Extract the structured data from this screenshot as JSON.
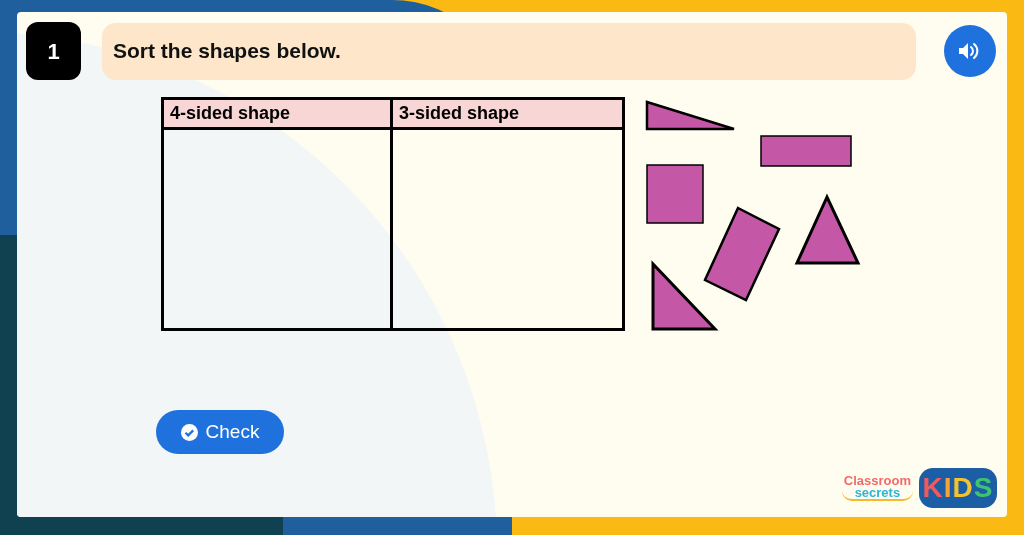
{
  "question": {
    "number": "1",
    "prompt": "Sort the shapes below."
  },
  "table": {
    "columns": [
      "4-sided shape",
      "3-sided shape"
    ]
  },
  "check_button": {
    "label": "Check"
  },
  "logo": {
    "line_1": "Classroom",
    "line_2": "secrets",
    "badge": "KIDS"
  }
}
